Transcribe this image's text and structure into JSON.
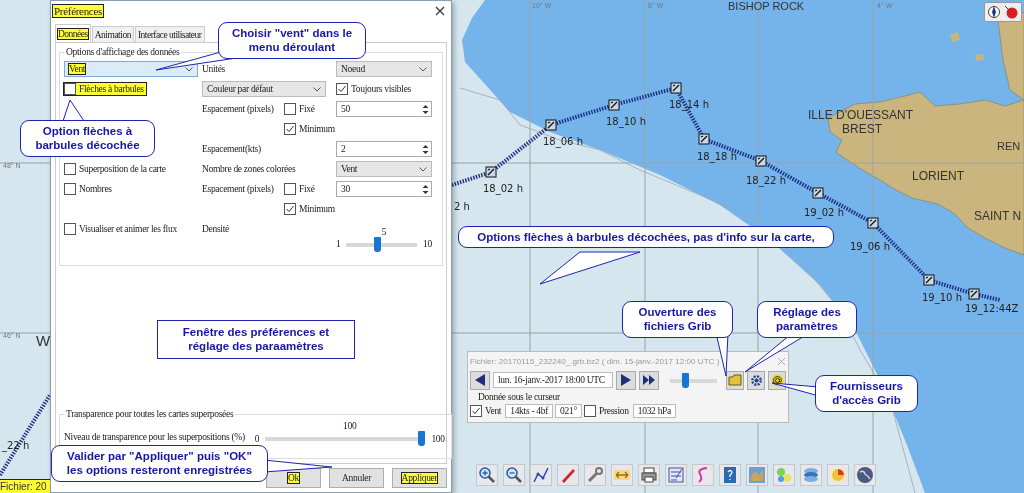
{
  "map": {
    "grid_labels": [
      "10° W",
      "8° W",
      "4° W",
      "48° N",
      "46° N"
    ],
    "places": [
      "BISHOP ROCK",
      "ILLE D'OUESSANT",
      "BREST",
      "LORIENT",
      "REN",
      "SAINT N",
      "W"
    ],
    "waypoints": [
      "18_02 h",
      "18_06 h",
      "18_10 h",
      "18_14 h",
      "18_18 h",
      "18_22 h",
      "19_02 h",
      "19_06 h",
      "19_10 h",
      "19_12:44Z"
    ],
    "edge_labels": [
      "2 h",
      "_22 h"
    ]
  },
  "status_bar": {
    "text": "Fichier: 20",
    "highlighted": true
  },
  "dialog": {
    "title": {
      "text": "Préférences",
      "highlighted": true
    },
    "tabs": [
      {
        "label": "Données",
        "selected": true,
        "highlighted": true
      },
      {
        "label": "Animation",
        "selected": false,
        "highlighted": false
      },
      {
        "label": "Interface utilisateur",
        "selected": false,
        "highlighted": false
      }
    ],
    "options": {
      "title": "Options d'affichage des données",
      "type_select": {
        "value": "Vent",
        "highlighted": true
      },
      "units_label": "Unités",
      "units_select": "Noeud",
      "barbs": {
        "label": "Flèches à barbules",
        "checked": false,
        "highlighted": true
      },
      "color_select": "Couleur par défaut",
      "always_visible": {
        "label": "Toujours visibles",
        "checked": true
      },
      "spacing_px": {
        "label": "Espacement (pixels)",
        "fixed": {
          "label": "Fixé",
          "checked": false
        },
        "minimum": {
          "label": "Minimum",
          "checked": true
        },
        "value": "50"
      },
      "spacing_kts": {
        "label": "Espacement(kts)",
        "value": "2"
      },
      "overlay": {
        "label": "Superposition de la carte",
        "checked": false
      },
      "zones": {
        "label": "Nombre de zones colorées",
        "select": "Vent"
      },
      "numbers": {
        "label": "Nombres",
        "checked": false
      },
      "numbers_spacing": {
        "label": "Espacement (pixels)",
        "fixed": {
          "label": "Fixé",
          "checked": false
        },
        "minimum": {
          "label": "Minimum",
          "checked": true
        },
        "value": "30"
      },
      "flux": {
        "label": "Visualiser et animer les flux",
        "checked": false
      },
      "density": {
        "label": "Densité",
        "value": "5",
        "min": "1",
        "max": "10",
        "level": 0.44
      }
    },
    "transparency": {
      "title": "Transparence pour toutes les cartes superposées",
      "label": "Niveau de transparence pour les superpositions (%)",
      "value": "100",
      "min": "0",
      "max": "100",
      "level": 1
    },
    "buttons": [
      {
        "label": "Ok",
        "highlighted": true
      },
      {
        "label": "Annuler",
        "highlighted": false
      },
      {
        "label": "Appliquer",
        "highlighted": true
      }
    ]
  },
  "grib_panel": {
    "title": "Fichier: 20170115_232240_.grb.bz2 ( dim. 15-janv.-2017 12:00 UTC )",
    "date_select": "lun. 16-janv.-2017 18:00  UTC",
    "time_slider": {
      "level": 0.3
    },
    "cursor_label": "Donnée sous le curseur",
    "wind": {
      "label": "Vent",
      "checked": true,
      "speed": "14kts - 4bf",
      "direction": "021°"
    },
    "pressure": {
      "label": "Pression",
      "checked": false,
      "value": "1032 hPa"
    }
  },
  "callouts": [
    {
      "text": "Choisir \"vent\" dans le menu déroulant",
      "kind": "bubble"
    },
    {
      "text": "Option flèches à barbules décochée",
      "kind": "bubble"
    },
    {
      "text": "Fenêtre des préférences et réglage des paraamètres",
      "kind": "box"
    },
    {
      "text": "Valider par \"Appliquer\" puis \"OK\" les options resteront enregistrées",
      "kind": "bubble"
    },
    {
      "text": "Options flèches à barbules décochées, pas d'info sur la carte,",
      "kind": "bubble"
    },
    {
      "text": "Ouverture des fichiers Grib",
      "kind": "bubble"
    },
    {
      "text": "Réglage des paramètres",
      "kind": "bubble"
    },
    {
      "text": "Fournisseurs d'accès Grib",
      "kind": "bubble"
    }
  ]
}
